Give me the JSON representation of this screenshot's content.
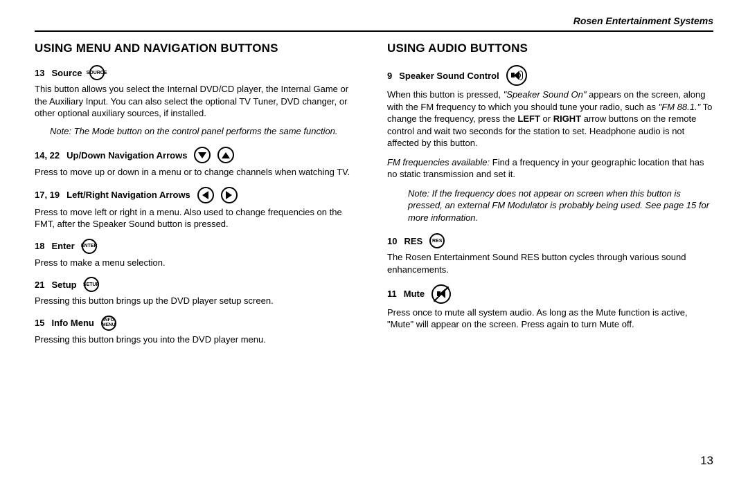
{
  "brand": "Rosen Entertainment Systems",
  "page_number": "13",
  "left": {
    "heading": "Using Menu And Navigation Buttons",
    "items": {
      "source": {
        "num": "13",
        "label": "Source",
        "icon_text": "SOURCE",
        "body": "This button allows you select the Internal DVD/CD player, the Internal Game or the Auxiliary Input. You can also select the optional TV Tuner, DVD changer, or other optional auxiliary sources, if installed.",
        "note": "Note: The Mode button on the control panel performs the same function."
      },
      "updown": {
        "num": "14, 22",
        "label": "Up/Down Navigation Arrows",
        "body": "Press to move up or down in a menu or to change channels when watching TV."
      },
      "leftright": {
        "num": "17, 19",
        "label": "Left/Right Navigation Arrows",
        "body": "Press to move left or right in a menu. Also used to change frequencies on the FMT, after the Speaker Sound button is pressed."
      },
      "enter": {
        "num": "18",
        "label": "Enter",
        "icon_text": "ENTER",
        "body": "Press to make a menu selection."
      },
      "setup": {
        "num": "21",
        "label": "Setup",
        "icon_text": "SETUP",
        "body": "Pressing this button brings up the DVD player setup screen."
      },
      "infomenu": {
        "num": "15",
        "label": "Info Menu",
        "icon_line1": "INFO",
        "icon_line2": "MENU",
        "body": "Pressing this button brings you into the DVD player menu."
      }
    }
  },
  "right": {
    "heading": "Using Audio Buttons",
    "items": {
      "speaker": {
        "num": "9",
        "label": "Speaker Sound Control",
        "body_pre": "When this button is pressed, ",
        "body_quote1": "\"Speaker Sound On\"",
        "body_mid1": " appears on the screen, along with the FM frequency to which you should tune your radio, such as ",
        "body_quote2": "\"FM 88.1.\"",
        "body_mid2": " To change the frequency, press the ",
        "body_bold1": "LEFT",
        "body_or": " or ",
        "body_bold2": "RIGHT",
        "body_post": " arrow buttons on the remote control and wait two seconds for the station to set. Headphone audio is not affected by this button.",
        "freq_label": "FM frequencies available:",
        "freq_body": " Find a frequency in your geographic location that has no static transmission and set it.",
        "note": "Note: If the frequency does not appear on screen when this button is pressed, an external FM Modulator is probably being used. See page 15 for more information."
      },
      "res": {
        "num": "10",
        "label": "RES",
        "icon_text": "RES",
        "body": "The Rosen Entertainment Sound RES button cycles through various sound enhancements."
      },
      "mute": {
        "num": "11",
        "label": "Mute",
        "body": "Press once to mute all system audio. As long as the Mute function is active, \"Mute\" will appear on the screen. Press again to turn Mute off."
      }
    }
  }
}
